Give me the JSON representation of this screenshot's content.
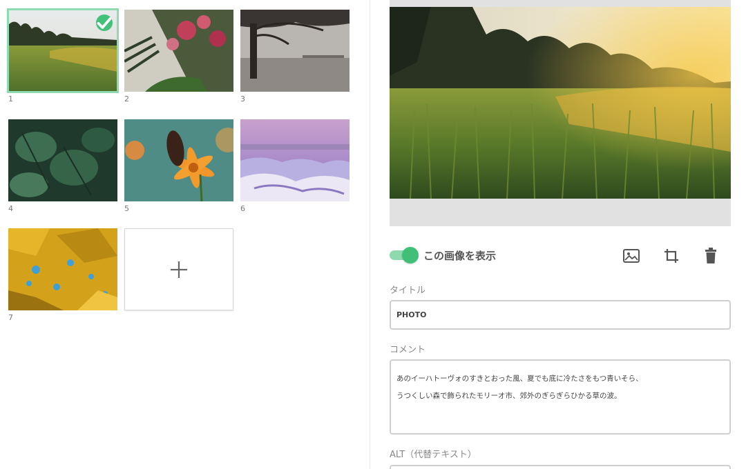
{
  "gallery": {
    "tiles": [
      {
        "number": "1",
        "selected": true,
        "scene": "grass-sunset"
      },
      {
        "number": "2",
        "selected": false,
        "scene": "flowers-leaves"
      },
      {
        "number": "3",
        "selected": false,
        "scene": "tree-fog"
      },
      {
        "number": "4",
        "selected": false,
        "scene": "green-leaves"
      },
      {
        "number": "5",
        "selected": false,
        "scene": "butterfly-flower"
      },
      {
        "number": "6",
        "selected": false,
        "scene": "purple-clouds"
      },
      {
        "number": "7",
        "selected": false,
        "scene": "yellow-foliage"
      }
    ],
    "add_icon": "plus-icon",
    "selected_icon": "check-icon"
  },
  "editor": {
    "preview_scene": "grass-sunset",
    "visibility_toggle": {
      "label": "この画像を表示",
      "on": true
    },
    "tools": [
      "image-icon",
      "crop-icon",
      "trash-icon"
    ],
    "title_label": "タイトル",
    "title_value": "PHOTO",
    "comment_label": "コメント",
    "comment_lines": [
      "あのイーハトーヴォのすきとおった風、夏でも底に冷たさをもつ青いそら、",
      "うつくしい森で飾られたモリーオ市、郊外のぎらぎらひかる草の波。"
    ],
    "alt_label": "ALT（代替テキスト）"
  },
  "colors": {
    "accent": "#3fbf78",
    "accent_light": "#8fd9ae",
    "selected_border": "#8fdab0",
    "frame_gray": "#e1e1e1"
  }
}
